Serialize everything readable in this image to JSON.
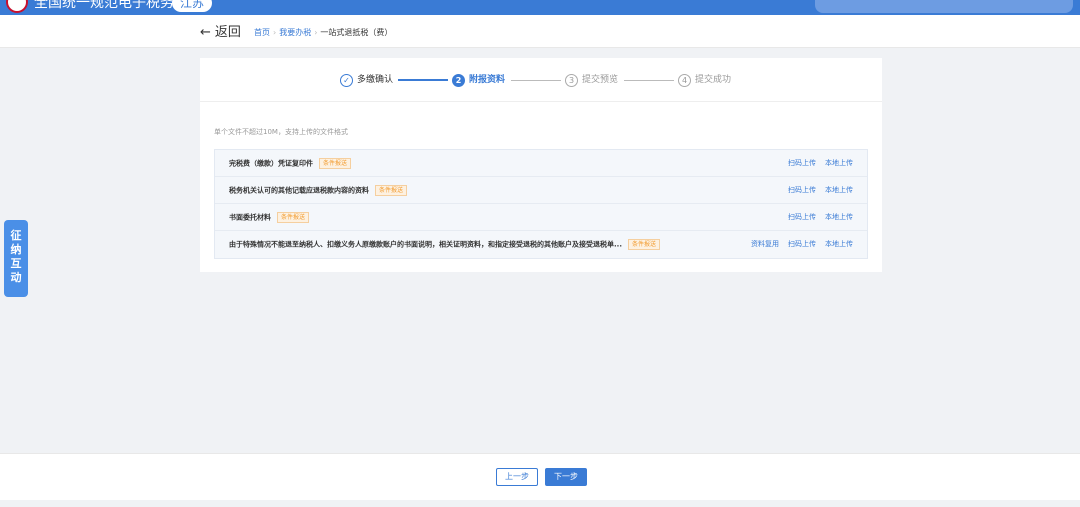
{
  "topbar": {
    "site_title": "全国统一规范电子税务局",
    "region_label": "江苏",
    "brand_color": "#3a7bd5"
  },
  "nav": {
    "back_label": "返回",
    "breadcrumb": [
      "首页",
      "我要办税",
      "一站式退抵税（费）"
    ]
  },
  "steps": [
    {
      "label": "多缴确认",
      "marker": "✓",
      "state": "done"
    },
    {
      "label": "附报资料",
      "marker": "2",
      "state": "active"
    },
    {
      "label": "提交预览",
      "marker": "3",
      "state": "todo"
    },
    {
      "label": "提交成功",
      "marker": "4",
      "state": "todo"
    }
  ],
  "upload": {
    "hint": "单个文件不超过10M，支持上传的文件格式",
    "rows": [
      {
        "name": "完税费（缴款）凭证复印件",
        "tag": "条件报送",
        "actions": [
          "扫码上传",
          "本地上传"
        ]
      },
      {
        "name": "税务机关认可的其他记载应退税款内容的资料",
        "tag": "条件报送",
        "actions": [
          "扫码上传",
          "本地上传"
        ]
      },
      {
        "name": "书面委托材料",
        "tag": "条件报送",
        "actions": [
          "扫码上传",
          "本地上传"
        ]
      },
      {
        "name": "由于特殊情况不能退至纳税人、扣缴义务人原缴款账户的书面说明，相关证明资料，和指定接受退税的其他账户及接受退税单...",
        "tag": "条件报送",
        "actions": [
          "资料复用",
          "扫码上传",
          "本地上传"
        ]
      }
    ]
  },
  "side_tab": {
    "chars": [
      "征",
      "纳",
      "互",
      "动"
    ]
  },
  "footer": {
    "prev_label": "上一步",
    "next_label": "下一步"
  }
}
